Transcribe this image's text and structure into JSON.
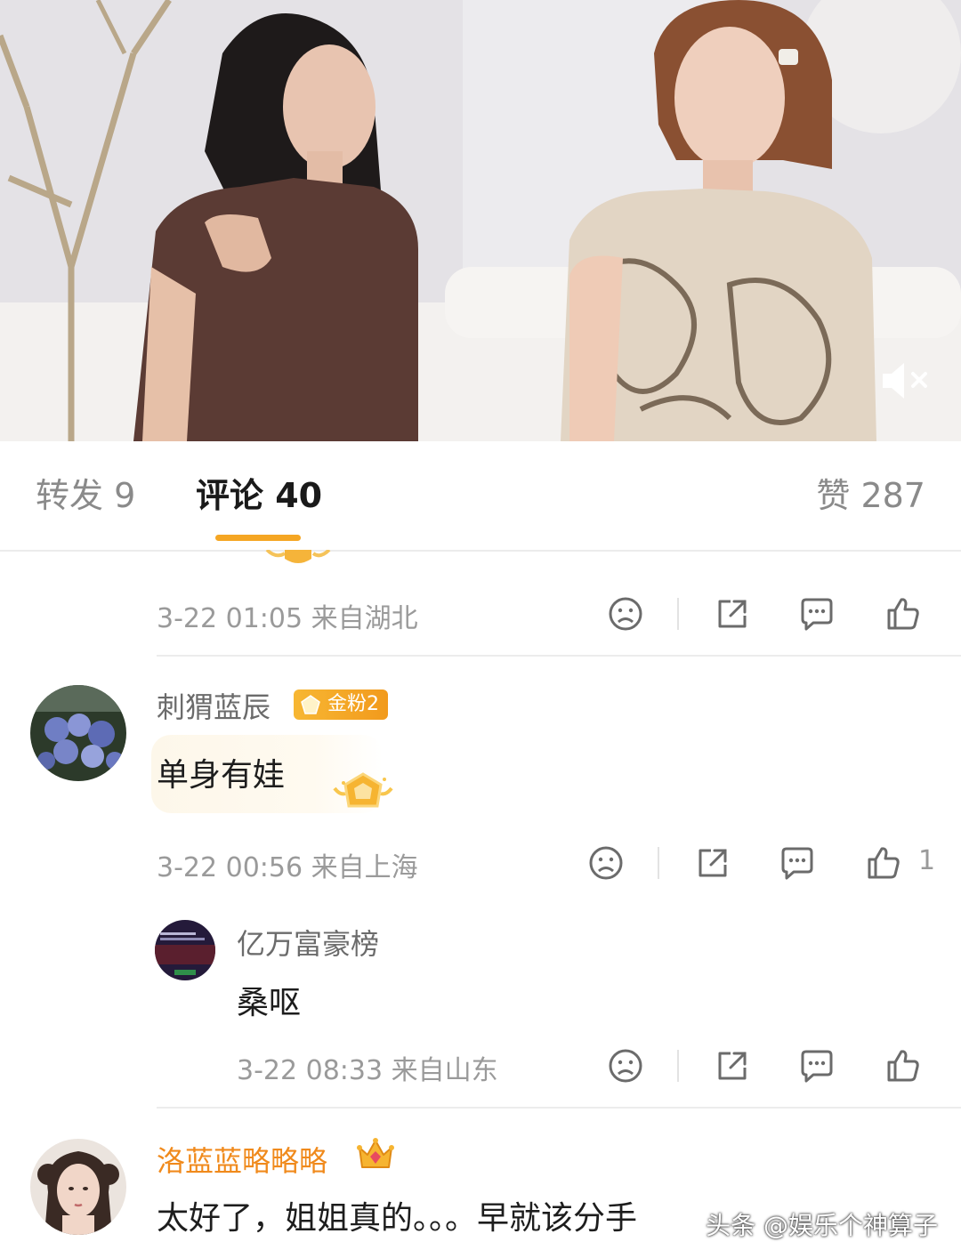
{
  "tabs": {
    "repost": "转发 9",
    "comments": "评论 40",
    "likes": "赞 287"
  },
  "comments": [
    {
      "id": "prev",
      "meta": "3-22 01:05  来自湖北"
    },
    {
      "id": "c1",
      "username": "刺猬蓝辰",
      "badge": "金粉2",
      "text": "单身有娃",
      "meta": "3-22 00:56  来自上海",
      "like_count": "1",
      "reply": {
        "username": "亿万富豪榜",
        "text": "桑呕",
        "meta": "3-22 08:33  来自山东"
      }
    },
    {
      "id": "c2",
      "username": "洛蓝蓝略略略",
      "text": "太好了，姐姐真的。。。早就该分手"
    }
  ],
  "watermark": "头条 @娱乐个神算子",
  "colors": {
    "accent": "#f5a623",
    "vip_name": "#f08a1c",
    "meta": "#9a9a9a"
  }
}
